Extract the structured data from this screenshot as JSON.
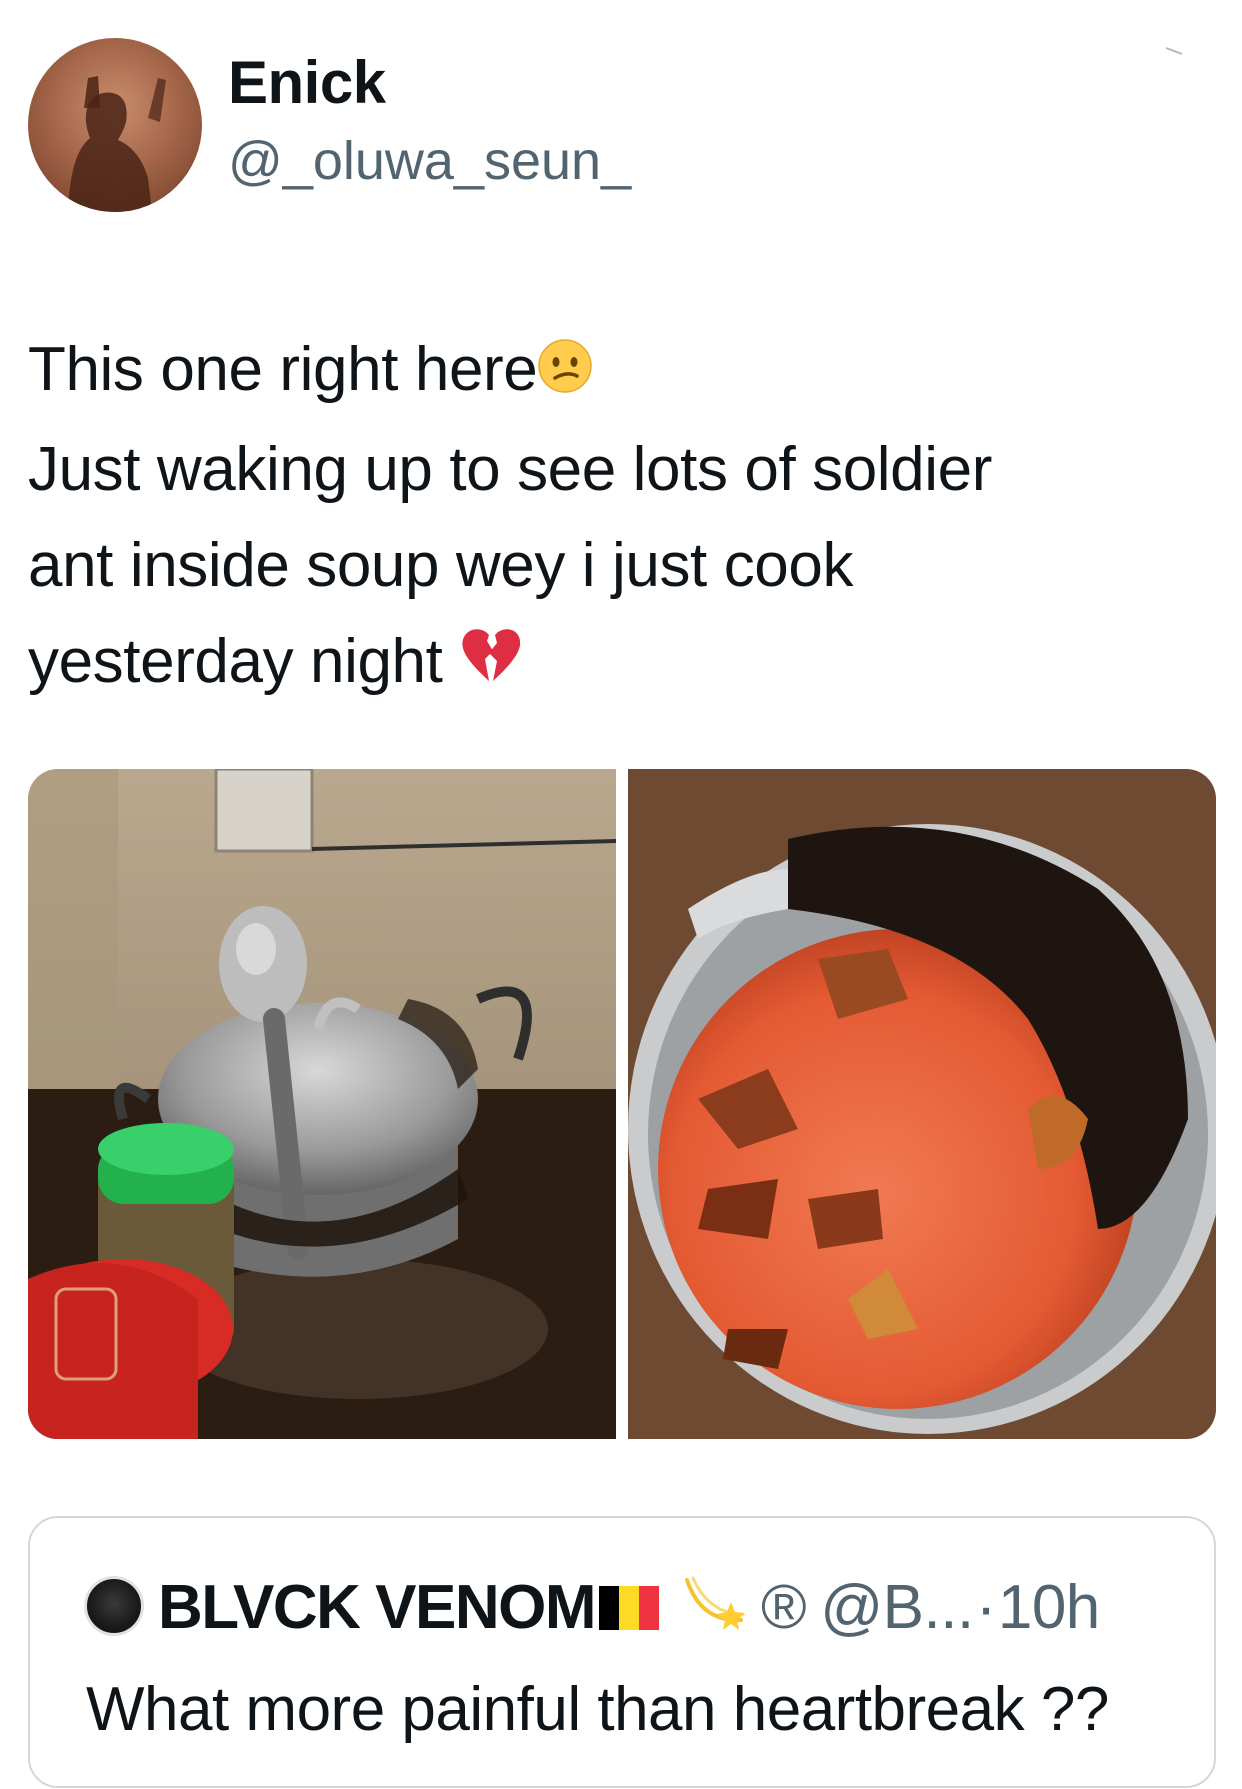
{
  "author": {
    "display_name": "Enick",
    "handle": "@_oluwa_seun_"
  },
  "tweet": {
    "line1": "This one right here",
    "line1_emoji": "confused-face",
    "line2": "Just waking up to see lots of soldier",
    "line3": "ant inside soup wey i just cook",
    "line4": "yesterday night",
    "line4_emoji": "broken-heart"
  },
  "media": {
    "photos": [
      {
        "subject": "pot-with-ladle-covered-in-ants"
      },
      {
        "subject": "pot-of-red-soup-with-ants"
      }
    ]
  },
  "quote_tweet": {
    "display_name": "BLVCK VENOM",
    "flag": "belgium-flag",
    "flag_colors": [
      "#000000",
      "#FDDA24",
      "#EF3340"
    ],
    "badge": "®",
    "handle": "@B...",
    "separator": "·",
    "time": "10h",
    "text": "What more painful than heartbreak ??"
  },
  "colors": {
    "text": "#0f1419",
    "secondary": "#536471",
    "border": "#cfd9de"
  }
}
